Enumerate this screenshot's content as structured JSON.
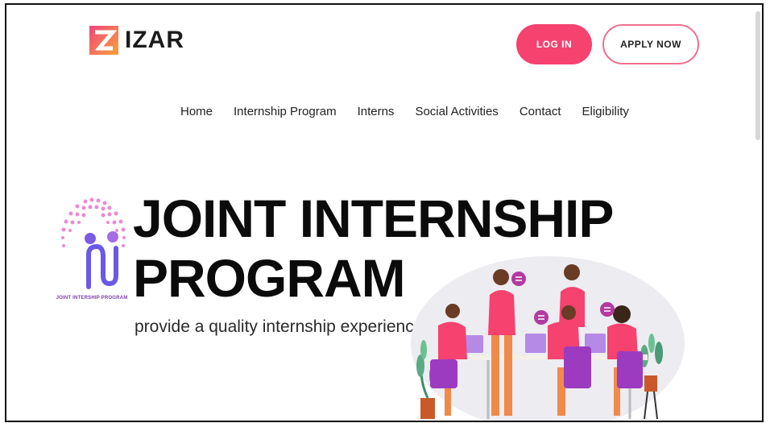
{
  "brand": {
    "name": "IZAR",
    "logo_icon": "izar-logo-icon"
  },
  "header": {
    "login_label": "LOG IN",
    "apply_label": "APPLY NOW"
  },
  "nav": {
    "items": [
      {
        "label": "Home"
      },
      {
        "label": "Internship Program"
      },
      {
        "label": "Interns"
      },
      {
        "label": "Social Activities"
      },
      {
        "label": "Contact"
      },
      {
        "label": "Eligibility"
      }
    ]
  },
  "hero": {
    "title_line1": "JOINT INTERNSHIP",
    "title_line2": "PROGRAM",
    "tagline": "provide a quality internship experience.",
    "program_logo_caption": "JOINT INTERSHIP PROGRAM",
    "illustration_icon": "team-meeting-illustration"
  },
  "colors": {
    "accent": "#f5426f",
    "accent_outline": "#f06e8e",
    "purple": "#9c3bc0",
    "orange": "#f08a4b"
  }
}
